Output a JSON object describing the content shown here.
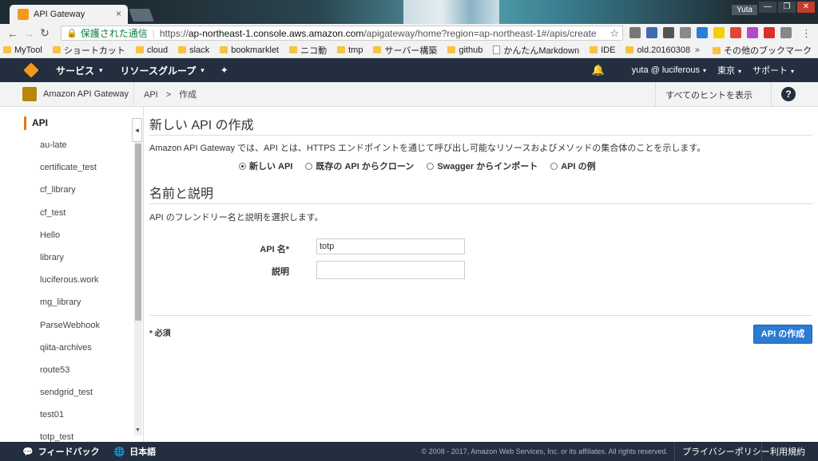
{
  "browser": {
    "tab_title": "API Gateway",
    "tab_close": "×",
    "window_user": "Yuta",
    "window_buttons": [
      "—",
      "❐",
      "✕"
    ],
    "secure_label": "保護された通信",
    "url_prefix": "https://",
    "url_host": "ap-northeast-1.console.aws.amazon.com",
    "url_path": "/apigateway/home?region=ap-northeast-1#/apis/create",
    "bookmarks": [
      {
        "label": "MyTool",
        "kind": "folder"
      },
      {
        "label": "ショートカット",
        "kind": "folder"
      },
      {
        "label": "cloud",
        "kind": "folder"
      },
      {
        "label": "slack",
        "kind": "folder"
      },
      {
        "label": "bookmarklet",
        "kind": "folder"
      },
      {
        "label": "ニコ動",
        "kind": "folder"
      },
      {
        "label": "tmp",
        "kind": "folder"
      },
      {
        "label": "サーバー構築",
        "kind": "folder"
      },
      {
        "label": "github",
        "kind": "folder"
      },
      {
        "label": "かんたんMarkdown",
        "kind": "doc"
      },
      {
        "label": "IDE",
        "kind": "folder"
      },
      {
        "label": "old.20160308",
        "kind": "folder"
      }
    ],
    "bookmarks_overflow": "»",
    "other_bookmarks": "その他のブックマーク",
    "ext_colors": [
      "#777777",
      "#3d6bb3",
      "#555555",
      "#888888",
      "#2a7ed6",
      "#f5d000",
      "#e0463b",
      "#b04cc8",
      "#d6322a",
      "#888888"
    ]
  },
  "aws_header": {
    "services": "サービス",
    "resource_groups": "リソースグループ",
    "account": "yuta @ luciferous",
    "region": "東京",
    "support": "サポート"
  },
  "subheader": {
    "service_name": "Amazon API Gateway",
    "breadcrumb": [
      "API",
      "作成"
    ],
    "hint": "すべてのヒントを表示",
    "help": "?"
  },
  "sidebar": {
    "title": "API",
    "items": [
      "au-late",
      "certificate_test",
      "cf_library",
      "cf_test",
      "Hello",
      "library",
      "luciferous.work",
      "mg_library",
      "ParseWebhook",
      "qiita-archives",
      "route53",
      "sendgrid_test",
      "test01",
      "totp_test"
    ]
  },
  "main": {
    "title": "新しい API の作成",
    "description": "Amazon API Gateway では、API とは、HTTPS エンドポイントを通じて呼び出し可能なリソースおよびメソッドの集合体のことを示します。",
    "options": [
      {
        "label": "新しい API",
        "selected": true
      },
      {
        "label": "既存の API からクローン",
        "selected": false
      },
      {
        "label": "Swagger からインポート",
        "selected": false
      },
      {
        "label": "API の例",
        "selected": false
      }
    ],
    "section_title": "名前と説明",
    "section_desc": "API のフレンドリー名と説明を選択します。",
    "name_label": "API 名*",
    "name_value": "totp",
    "desc_label": "説明",
    "desc_value": "",
    "required_note": "* 必須",
    "create_button": "API の作成"
  },
  "footer": {
    "feedback": "フィードバック",
    "language": "日本語",
    "copyright": "© 2008 - 2017, Amazon Web Services, Inc. or its affiliates. All rights reserved.",
    "privacy": "プライバシーポリシー",
    "terms": "利用規約"
  }
}
